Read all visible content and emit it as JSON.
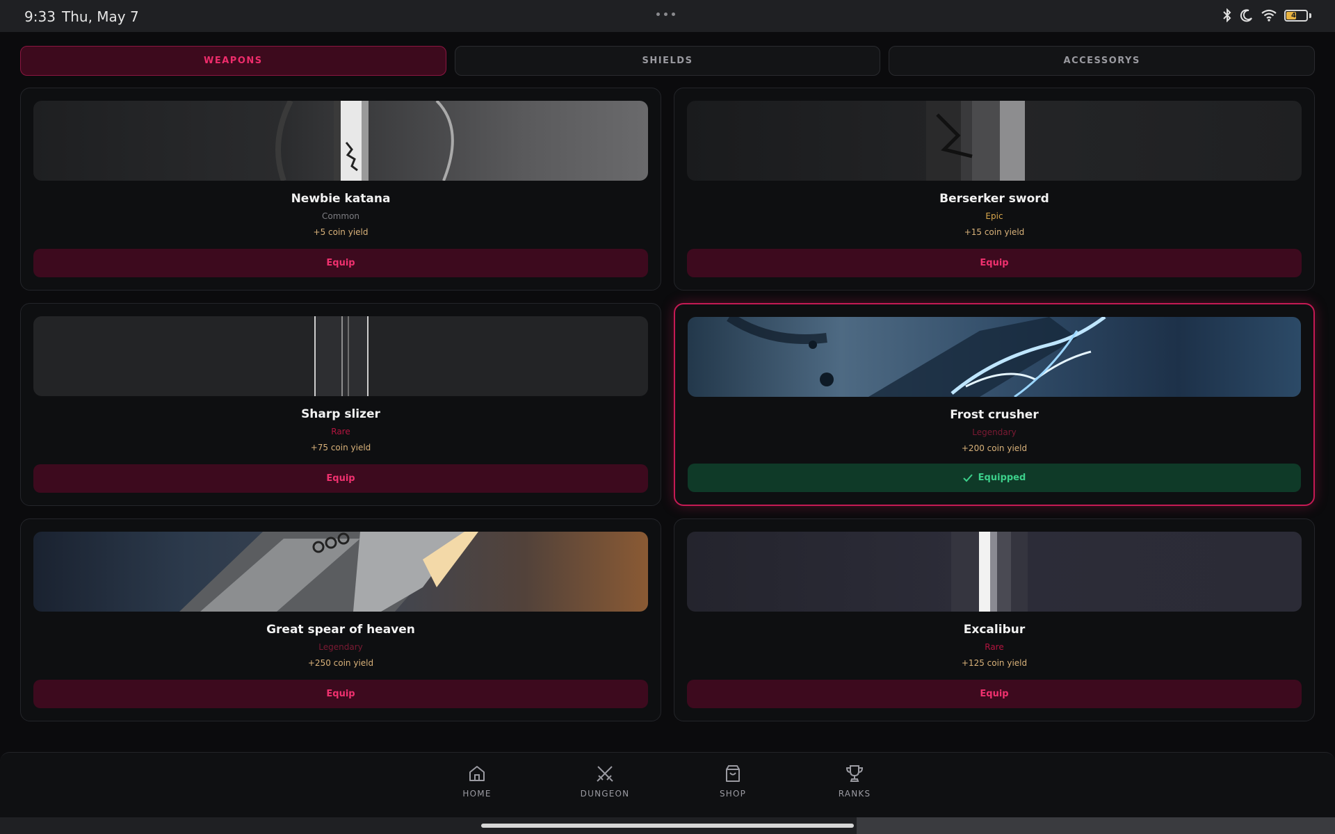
{
  "status_bar": {
    "time": "9:33",
    "date": "Thu, May 7",
    "battery_level": "46",
    "icons": [
      "bluetooth-icon",
      "moon-icon",
      "wifi-icon",
      "battery-icon"
    ]
  },
  "tabs": [
    {
      "label": "WEAPONS",
      "active": true
    },
    {
      "label": "SHIELDS",
      "active": false
    },
    {
      "label": "ACCESSORYS",
      "active": false
    }
  ],
  "items": [
    {
      "name": "Newbie katana",
      "rarity": "Common",
      "yield": "+5 coin yield",
      "button": "Equip",
      "equipped": false,
      "rarity_color": "#7d7d82"
    },
    {
      "name": "Berserker sword",
      "rarity": "Epic",
      "yield": "+15 coin yield",
      "button": "Equip",
      "equipped": false,
      "rarity_color": "#d9a74c"
    },
    {
      "name": "Sharp slizer",
      "rarity": "Rare",
      "yield": "+75 coin yield",
      "button": "Equip",
      "equipped": false,
      "rarity_color": "#b3143f"
    },
    {
      "name": "Frost crusher",
      "rarity": "Legendary",
      "yield": "+200 coin yield",
      "button": "Equipped",
      "equipped": true,
      "rarity_color": "#7b1a33"
    },
    {
      "name": "Great spear of heaven",
      "rarity": "Legendary",
      "yield": "+250 coin yield",
      "button": "Equip",
      "equipped": false,
      "rarity_color": "#7b1a33"
    },
    {
      "name": "Excalibur",
      "rarity": "Rare",
      "yield": "+125 coin yield",
      "button": "Equip",
      "equipped": false,
      "rarity_color": "#b3143f"
    }
  ],
  "nav": [
    {
      "label": "HOME",
      "icon": "home-icon"
    },
    {
      "label": "DUNGEON",
      "icon": "crossed-swords-icon"
    },
    {
      "label": "SHOP",
      "icon": "shopping-bag-icon"
    },
    {
      "label": "RANKS",
      "icon": "trophy-icon"
    }
  ],
  "colors": {
    "accent": "#ee2c6b",
    "equipped_green": "#3ccf8a",
    "background": "#0b0b0d"
  }
}
